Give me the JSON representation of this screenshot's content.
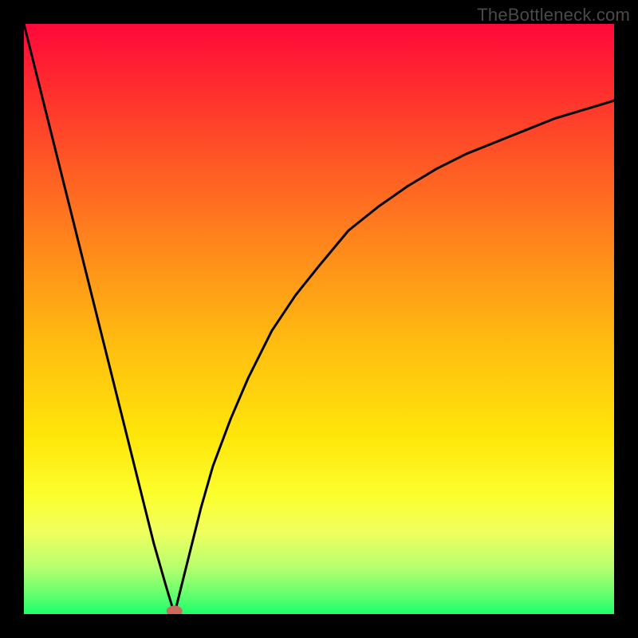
{
  "watermark": "TheBottleneck.com",
  "chart_data": {
    "type": "line",
    "title": "",
    "xlabel": "",
    "ylabel": "",
    "xlim": [
      0,
      100
    ],
    "ylim": [
      0,
      100
    ],
    "grid": false,
    "legend": false,
    "series": [
      {
        "name": "left-branch",
        "x": [
          0,
          2,
          4,
          6,
          8,
          10,
          12,
          14,
          16,
          18,
          20,
          22,
          24,
          25.5
        ],
        "y": [
          100,
          92,
          84,
          76,
          68,
          60,
          52,
          44,
          36,
          28,
          20,
          12,
          5,
          0
        ]
      },
      {
        "name": "right-branch",
        "x": [
          25.5,
          26,
          27,
          28,
          30,
          32,
          35,
          38,
          42,
          46,
          50,
          55,
          60,
          65,
          70,
          75,
          80,
          85,
          90,
          95,
          100
        ],
        "y": [
          0,
          2,
          6,
          10,
          18,
          25,
          33,
          40,
          48,
          54,
          59,
          65,
          69,
          72.5,
          75.5,
          78,
          80,
          82,
          84,
          85.5,
          87
        ]
      }
    ],
    "marker": {
      "name": "min-point",
      "x": 25.5,
      "y": 0.5,
      "color": "#cc6a5c"
    },
    "background_gradient": {
      "stops": [
        {
          "offset": 0,
          "color": "#ff083a"
        },
        {
          "offset": 0.1,
          "color": "#ff2a2f"
        },
        {
          "offset": 0.25,
          "color": "#ff5d24"
        },
        {
          "offset": 0.4,
          "color": "#ff8f1a"
        },
        {
          "offset": 0.55,
          "color": "#ffbf10"
        },
        {
          "offset": 0.7,
          "color": "#ffe60a"
        },
        {
          "offset": 0.8,
          "color": "#fbff2e"
        },
        {
          "offset": 0.86,
          "color": "#f0ff5e"
        },
        {
          "offset": 0.92,
          "color": "#b8ff6e"
        },
        {
          "offset": 0.97,
          "color": "#5eff6e"
        },
        {
          "offset": 1.0,
          "color": "#1aff6e"
        }
      ]
    }
  }
}
